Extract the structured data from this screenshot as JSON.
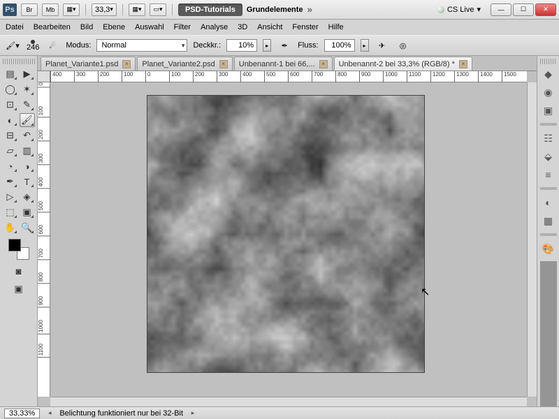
{
  "title": {
    "br": "Br",
    "mb": "Mb",
    "zoom": "33,3",
    "workspace_pill": "PSD-Tutorials",
    "workspace_name": "Grundelemente",
    "cslive": "CS Live"
  },
  "menu": [
    "Datei",
    "Bearbeiten",
    "Bild",
    "Ebene",
    "Auswahl",
    "Filter",
    "Analyse",
    "3D",
    "Ansicht",
    "Fenster",
    "Hilfe"
  ],
  "options": {
    "brush_size": "246",
    "mode_label": "Modus:",
    "mode_value": "Normal",
    "opacity_label": "Deckkr.:",
    "opacity_value": "10%",
    "flow_label": "Fluss:",
    "flow_value": "100%"
  },
  "tabs": [
    {
      "label": "Planet_Variante1.psd",
      "active": false
    },
    {
      "label": "Planet_Variante2.psd",
      "active": false
    },
    {
      "label": "Unbenannt-1 bei 66,...",
      "active": false
    },
    {
      "label": "Unbenannt-2 bei 33,3% (RGB/8) *",
      "active": true
    }
  ],
  "ruler_h": [
    "400",
    "300",
    "200",
    "100",
    "0",
    "100",
    "200",
    "300",
    "400",
    "500",
    "600",
    "700",
    "800",
    "900",
    "1000",
    "1100",
    "1200",
    "1300",
    "1400",
    "1500"
  ],
  "ruler_v": [
    "0",
    "100",
    "200",
    "300",
    "400",
    "500",
    "600",
    "700",
    "800",
    "900",
    "1000",
    "1100"
  ],
  "status": {
    "zoom": "33,33%",
    "note": "Belichtung funktioniert nur bei 32-Bit"
  },
  "tools_left": [
    [
      "move",
      "▤",
      "direct",
      "▶"
    ],
    [
      "lasso",
      "◯",
      "magic",
      "✶"
    ],
    [
      "crop",
      "⊡",
      "eyedrop",
      "✎"
    ],
    [
      "heal",
      "◐",
      "brush",
      "🖌"
    ],
    [
      "stamp",
      "⊟",
      "history",
      "↶"
    ],
    [
      "eraser",
      "▱",
      "grad",
      "▥"
    ],
    [
      "blur",
      "◔",
      "dodge",
      "◑"
    ],
    [
      "pen",
      "✒",
      "type",
      "T"
    ],
    [
      "path",
      "▷",
      "shape",
      "◈"
    ],
    [
      "3d",
      "⬚",
      "3dcam",
      "▣"
    ],
    [
      "hand",
      "✋",
      "zoom",
      "🔍"
    ]
  ],
  "panels_right": [
    "color",
    "swatch",
    "adjust",
    "mask",
    "char",
    "para",
    "contrast",
    "histo",
    "layers"
  ]
}
